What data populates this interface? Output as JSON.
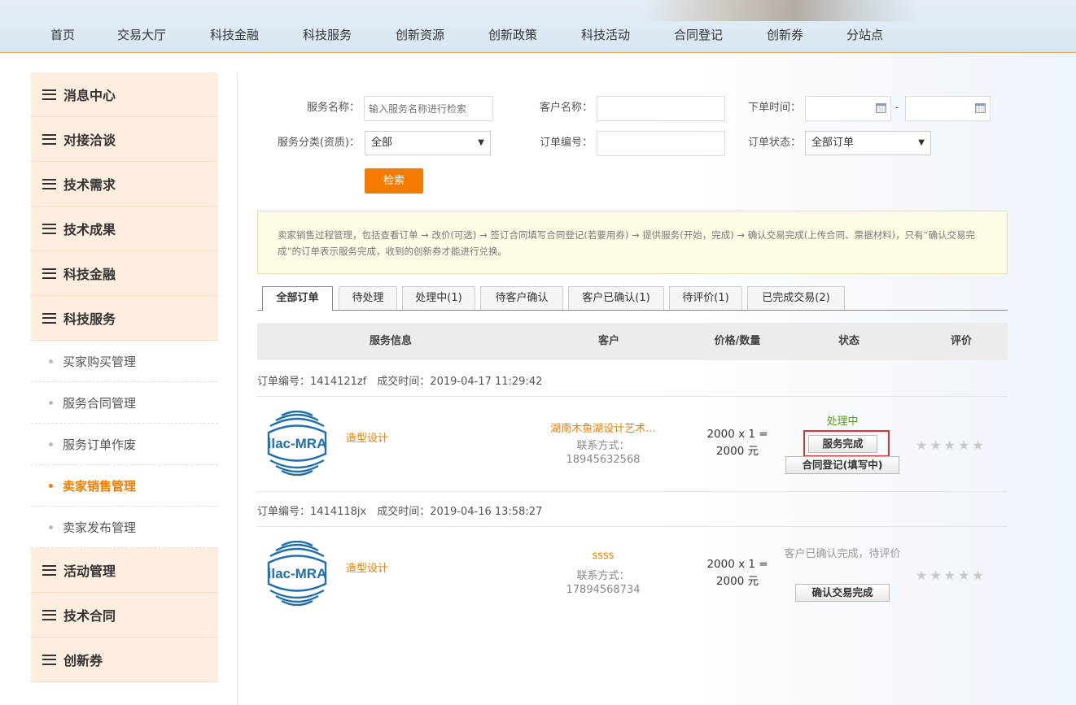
{
  "nav": [
    "首页",
    "交易大厅",
    "科技金融",
    "科技服务",
    "创新资源",
    "创新政策",
    "科技活动",
    "合同登记",
    "创新券",
    "分站点"
  ],
  "sidebar": {
    "main_top": [
      "消息中心",
      "对接洽谈",
      "技术需求",
      "技术成果",
      "科技金融",
      "科技服务"
    ],
    "sub": [
      "买家购买管理",
      "服务合同管理",
      "服务订单作废",
      "卖家销售管理",
      "卖家发布管理"
    ],
    "active_sub": "卖家销售管理",
    "main_bottom": [
      "活动管理",
      "技术合同",
      "创新券"
    ]
  },
  "filter": {
    "service_name_label": "服务名称：",
    "service_name_placeholder": "输入服务名称进行检索",
    "customer_name_label": "客户名称：",
    "order_time_label": "下单时间：",
    "date_sep": "-",
    "category_label": "服务分类(资质)：",
    "category_value": "全部",
    "order_no_label": "订单编号：",
    "order_status_label": "订单状态：",
    "order_status_value": "全部订单",
    "search_button": "检索"
  },
  "notice": "卖家销售过程管理，包括查看订单 → 改价(可选) → 签订合同填写合同登记(若要用券) → 提供服务(开始，完成) → 确认交易完成(上传合同、票据材料)，只有“确认交易完成”的订单表示服务完成，收到的创新券才能进行兑换。",
  "tabs": [
    "全部订单",
    "待处理",
    "处理中(1)",
    "待客户确认",
    "客户已确认(1)",
    "待评价(1)",
    "已完成交易(2)"
  ],
  "active_tab": "全部订单",
  "table_headers": [
    "服务信息",
    "客户",
    "价格/数量",
    "状态",
    "评价"
  ],
  "orders": [
    {
      "meta": "订单编号：1414121zf　成交时间：2019-04-17 11:29:42",
      "service": "造型设计",
      "customer": "湖南木鱼湖设计艺术...",
      "contact_label": "联系方式：",
      "contact_phone": "18945632568",
      "price_line1": "2000 x 1 =",
      "price_line2": "2000 元",
      "status": "处理中",
      "status_color": "#5a9a1a",
      "actions": [
        "服务完成",
        "合同登记(填写中)"
      ]
    },
    {
      "meta": "订单编号：1414118jx　成交时间：2019-04-16 13:58:27",
      "service": "造型设计",
      "customer": "ssss",
      "contact_label": "联系方式：",
      "contact_phone": "17894568734",
      "price_line1": "2000 x 1 =",
      "price_line2": "2000 元",
      "status": "客户已确认完成，待评价",
      "status_color": "#999999",
      "actions": [
        "确认交易完成"
      ]
    }
  ],
  "logo_text": "ilac-MRA",
  "star_char": "★",
  "accent_color": "#f47b00"
}
